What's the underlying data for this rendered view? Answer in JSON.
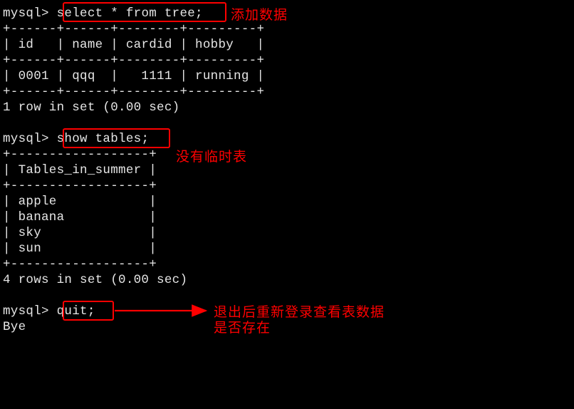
{
  "prompt": "mysql> ",
  "cmd1": "select * from tree;",
  "annotation1": "添加数据",
  "table1": {
    "sep": "+------+------+--------+---------+",
    "header": "| id   | name | cardid | hobby   |",
    "row": "| 0001 | qqq  |   1111 | running |"
  },
  "result1": "1 row in set (0.00 sec)",
  "cmd2": "show tables;",
  "annotation2": "没有临时表",
  "table2": {
    "sep": "+------------------+",
    "header": "| Tables_in_summer |",
    "rows": [
      "| apple            |",
      "| banana           |",
      "| sky              |",
      "| sun              |"
    ]
  },
  "result2": "4 rows in set (0.00 sec)",
  "cmd3": "quit;",
  "annotation3_line1": "退出后重新登录查看表数据",
  "annotation3_line2": "是否存在",
  "bye": "Bye"
}
